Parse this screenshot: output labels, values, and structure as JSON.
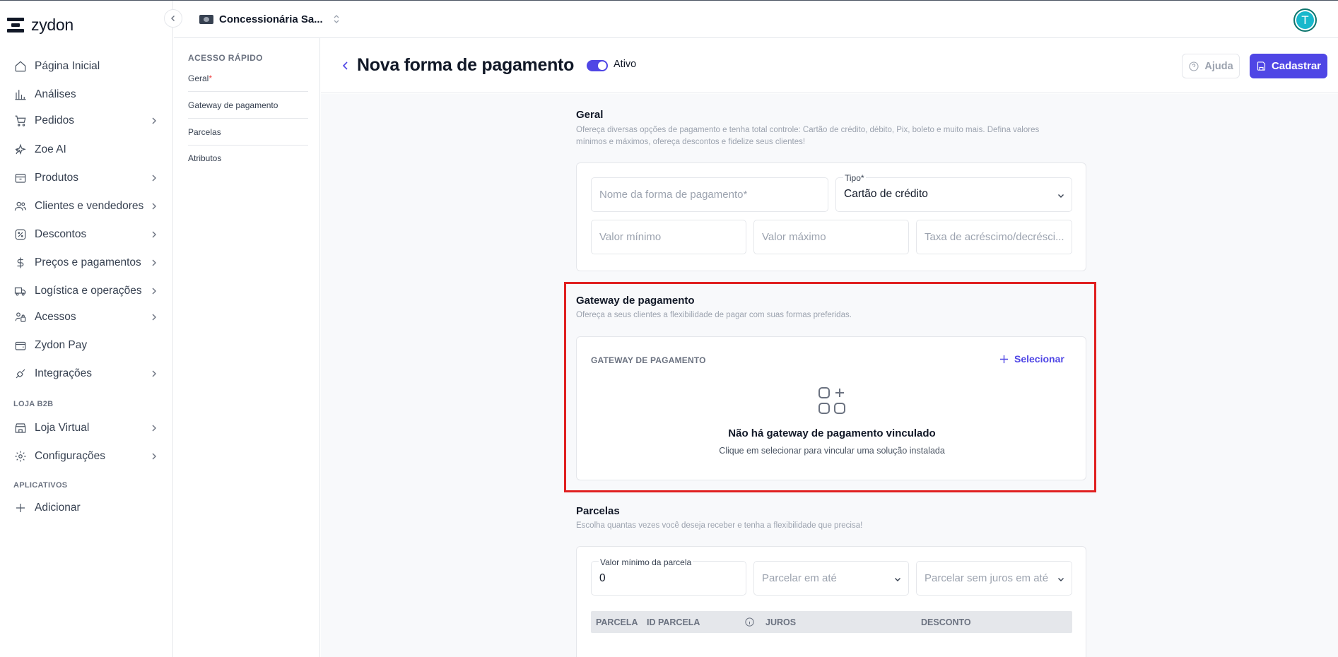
{
  "brand": {
    "name": "zydon"
  },
  "store": {
    "name": "Concessionária Sa..."
  },
  "user": {
    "initial": "T"
  },
  "sidebar": {
    "items": [
      {
        "label": "Página Inicial",
        "icon": "home-icon"
      },
      {
        "label": "Análises",
        "icon": "bar-chart-icon"
      },
      {
        "label": "Pedidos",
        "icon": "cart-icon"
      },
      {
        "label": "Zoe AI",
        "icon": "sparkles-icon"
      },
      {
        "label": "Produtos",
        "icon": "box-icon"
      },
      {
        "label": "Clientes e vendedores",
        "icon": "users-icon"
      },
      {
        "label": "Descontos",
        "icon": "discount-icon"
      },
      {
        "label": "Preços e pagamentos",
        "icon": "dollar-icon"
      },
      {
        "label": "Logística e operações",
        "icon": "truck-icon"
      },
      {
        "label": "Acessos",
        "icon": "access-icon"
      },
      {
        "label": "Zydon Pay",
        "icon": "wallet-icon"
      },
      {
        "label": "Integrações",
        "icon": "plug-icon"
      },
      {
        "label": "Loja Virtual",
        "icon": "storefront-icon"
      },
      {
        "label": "Configurações",
        "icon": "gear-icon"
      },
      {
        "label": "Adicionar",
        "icon": "plus-icon"
      }
    ],
    "sections": {
      "b2b": "LOJA B2B",
      "apps": "APLICATIVOS"
    }
  },
  "quick_access": {
    "title": "ACESSO RÁPIDO",
    "items": [
      "Geral",
      "Gateway de pagamento",
      "Parcelas",
      "Atributos"
    ],
    "required_mark": "*"
  },
  "header": {
    "title": "Nova forma de pagamento",
    "status_label": "Ativo",
    "help_label": "Ajuda",
    "submit_label": "Cadastrar"
  },
  "geral": {
    "title": "Geral",
    "description_1": "Ofereça diversas opções de pagamento e tenha total controle: Cartão de crédito, débito, Pix, boleto e muito mais. Defina valores",
    "description_2": "mínimos e máximos, ofereça descontos e fidelize seus clientes!",
    "name_placeholder": "Nome da forma de pagamento",
    "required_mark": "*",
    "type_label": "Tipo",
    "type_value": "Cartão de crédito",
    "min_placeholder": "Valor mínimo",
    "max_placeholder": "Valor máximo",
    "fee_placeholder": "Taxa de acréscimo/decrésci..."
  },
  "gateway": {
    "title": "Gateway de pagamento",
    "description": "Ofereça a seus clientes a flexibilidade de pagar com suas formas preferidas.",
    "card_header": "GATEWAY DE PAGAMENTO",
    "select_label": "Selecionar",
    "empty_title": "Não há gateway de pagamento vinculado",
    "empty_description": "Clique em selecionar para vincular uma solução instalada"
  },
  "parcelas": {
    "title": "Parcelas",
    "description": "Escolha quantas vezes você deseja receber e tenha a flexibilidade que precisa!",
    "min_label": "Valor mínimo da parcela",
    "min_value": "0",
    "parcelar_placeholder": "Parcelar em até",
    "sem_juros_placeholder": "Parcelar sem juros em até",
    "columns": [
      "PARCELA",
      "ID PARCELA",
      "JUROS",
      "DESCONTO"
    ]
  },
  "colors": {
    "primary": "#4f46e5",
    "highlight": "#e02020",
    "avatar": "#17b8cc"
  }
}
